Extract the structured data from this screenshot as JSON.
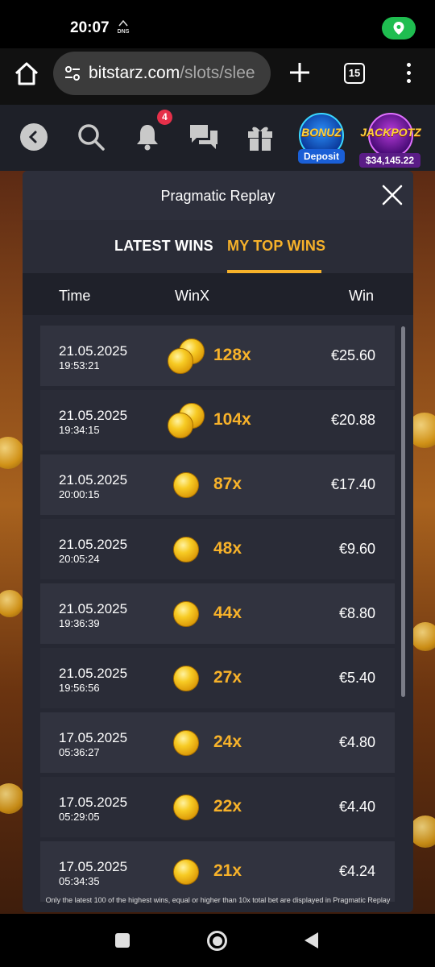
{
  "status_bar": {
    "time": "20:07",
    "dns_label": "DNS"
  },
  "browser": {
    "url_domain": "bitstarz.com",
    "url_path": "/slots/slee",
    "tab_count": "15"
  },
  "site_header": {
    "notification_count": "4",
    "bonuz": {
      "label": "BONUZ",
      "action": "Deposit"
    },
    "jackpot": {
      "label": "JACKPOTZ",
      "amount": "$34,145.22"
    }
  },
  "modal": {
    "title": "Pragmatic Replay",
    "tabs": {
      "latest": "LATEST WINS",
      "top": "MY TOP WINS"
    },
    "active_tab": "top",
    "columns": {
      "time": "Time",
      "winx": "WinX",
      "win": "Win"
    },
    "rows": [
      {
        "date": "21.05.2025",
        "time": "19:53:21",
        "multiplier": "128x",
        "amount": "€25.60",
        "coins": 2
      },
      {
        "date": "21.05.2025",
        "time": "19:34:15",
        "multiplier": "104x",
        "amount": "€20.88",
        "coins": 2
      },
      {
        "date": "21.05.2025",
        "time": "20:00:15",
        "multiplier": "87x",
        "amount": "€17.40",
        "coins": 1
      },
      {
        "date": "21.05.2025",
        "time": "20:05:24",
        "multiplier": "48x",
        "amount": "€9.60",
        "coins": 1
      },
      {
        "date": "21.05.2025",
        "time": "19:36:39",
        "multiplier": "44x",
        "amount": "€8.80",
        "coins": 1
      },
      {
        "date": "21.05.2025",
        "time": "19:56:56",
        "multiplier": "27x",
        "amount": "€5.40",
        "coins": 1
      },
      {
        "date": "17.05.2025",
        "time": "05:36:27",
        "multiplier": "24x",
        "amount": "€4.80",
        "coins": 1
      },
      {
        "date": "17.05.2025",
        "time": "05:29:05",
        "multiplier": "22x",
        "amount": "€4.40",
        "coins": 1
      },
      {
        "date": "17.05.2025",
        "time": "05:34:35",
        "multiplier": "21x",
        "amount": "€4.24",
        "coins": 1
      }
    ],
    "footer_note": "Only the latest 100 of the highest wins, equal or higher than 10x total bet are displayed in Pragmatic Replay"
  },
  "colors": {
    "accent": "#f7b22a",
    "modal_bg": "#262833",
    "row_bg": "#31333f",
    "location_green": "#1fbd50",
    "badge_red": "#e6304a"
  },
  "icons": [
    "home-icon",
    "site-settings-icon",
    "plus-icon",
    "tabs-icon",
    "more-vert-icon",
    "back-icon",
    "search-icon",
    "bell-icon",
    "chat-icon",
    "gift-icon",
    "close-icon",
    "coin-icon",
    "location-icon"
  ]
}
